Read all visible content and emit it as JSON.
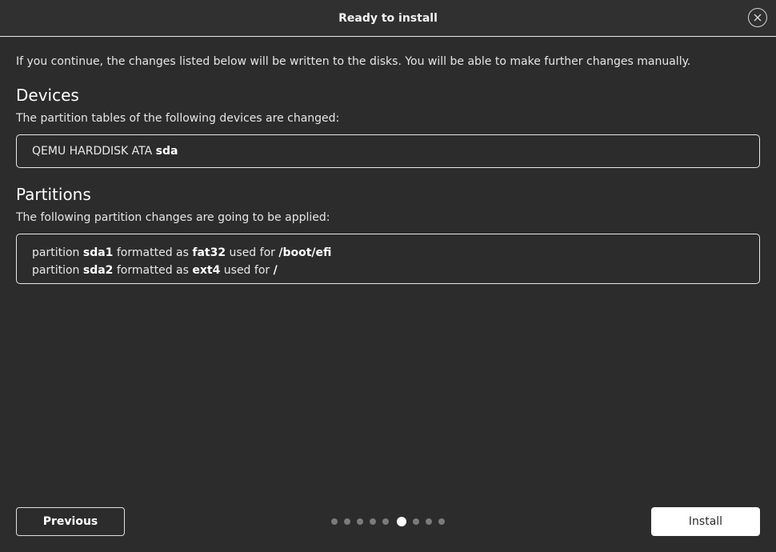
{
  "window": {
    "title": "Ready to install"
  },
  "intro": "If you continue, the changes listed below will be written to the disks. You will be able to make further changes manually.",
  "devices": {
    "title": "Devices",
    "description": "The partition tables of the following devices are changed:",
    "items": [
      {
        "name": "QEMU HARDDISK ATA",
        "device": "sda"
      }
    ]
  },
  "partitions": {
    "title": "Partitions",
    "description": "The following partition changes are going to be applied:",
    "items": [
      {
        "prefix": "partition",
        "partition": "sda1",
        "mid1": "formatted as",
        "fs": "fat32",
        "mid2": "used for",
        "mount": "/boot/efi"
      },
      {
        "prefix": "partition",
        "partition": "sda2",
        "mid1": "formatted as",
        "fs": "ext4",
        "mid2": "used for",
        "mount": "/"
      }
    ]
  },
  "footer": {
    "previous_label": "Previous",
    "install_label": "Install",
    "steps_total": 9,
    "current_step": 6
  },
  "icons": {
    "close": "close-icon"
  },
  "colors": {
    "background": "#2c2c2c",
    "active_dot": "#ffffff",
    "inactive_dot": "#7b7b7b"
  }
}
